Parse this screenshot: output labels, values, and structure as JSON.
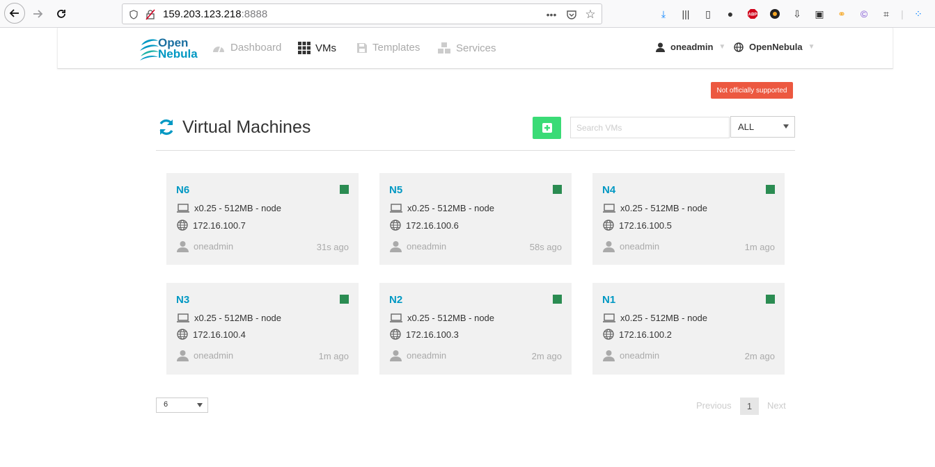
{
  "browser": {
    "url_host": "159.203.123.218",
    "url_port": ":8888"
  },
  "header": {
    "logo_line1": "Open",
    "logo_line2": "Nebula",
    "menu": [
      {
        "label": "Dashboard",
        "icon": "dashboard-icon"
      },
      {
        "label": "VMs",
        "icon": "grid-icon"
      },
      {
        "label": "Templates",
        "icon": "save-icon"
      },
      {
        "label": "Services",
        "icon": "cubes-icon"
      }
    ],
    "user": "oneadmin",
    "zone": "OpenNebula"
  },
  "badge": "Not officially supported",
  "page": {
    "title": "Virtual Machines",
    "search_placeholder": "Search VMs",
    "filter_value": "ALL"
  },
  "vms": [
    {
      "name": "N6",
      "spec": "x0.25 - 512MB - node",
      "ip": "172.16.100.7",
      "owner": "oneadmin",
      "time": "31s ago"
    },
    {
      "name": "N5",
      "spec": "x0.25 - 512MB - node",
      "ip": "172.16.100.6",
      "owner": "oneadmin",
      "time": "58s ago"
    },
    {
      "name": "N4",
      "spec": "x0.25 - 512MB - node",
      "ip": "172.16.100.5",
      "owner": "oneadmin",
      "time": "1m ago"
    },
    {
      "name": "N3",
      "spec": "x0.25 - 512MB - node",
      "ip": "172.16.100.4",
      "owner": "oneadmin",
      "time": "1m ago"
    },
    {
      "name": "N2",
      "spec": "x0.25 - 512MB - node",
      "ip": "172.16.100.3",
      "owner": "oneadmin",
      "time": "2m ago"
    },
    {
      "name": "N1",
      "spec": "x0.25 - 512MB - node",
      "ip": "172.16.100.2",
      "owner": "oneadmin",
      "time": "2m ago"
    }
  ],
  "pagination": {
    "page_size": "6",
    "previous": "Previous",
    "current": "1",
    "next": "Next"
  },
  "colors": {
    "accent": "#0098c3",
    "running": "#2b8c52",
    "add_button": "#3adb76",
    "alert": "#ec5840"
  }
}
